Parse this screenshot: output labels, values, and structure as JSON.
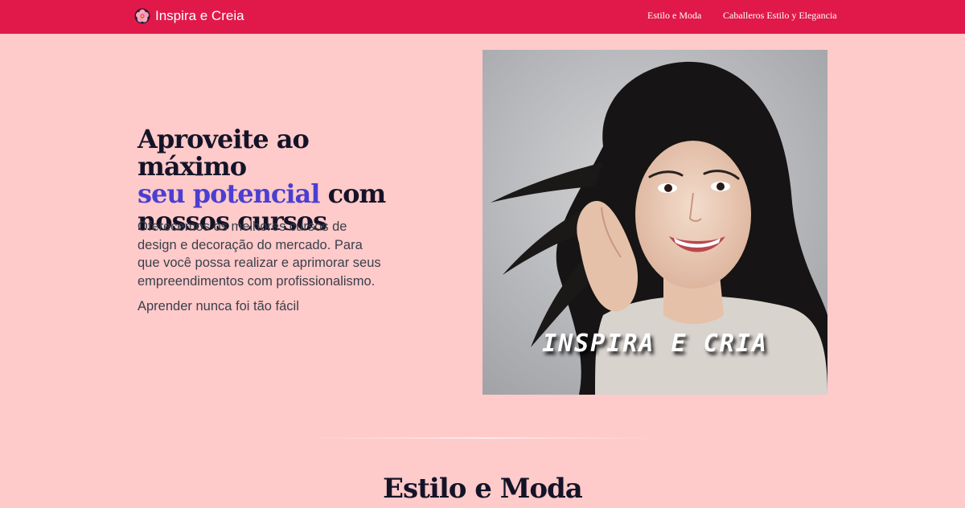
{
  "header": {
    "brand": "Inspira e Creia",
    "brand_icon": "flower-icon",
    "background_color": "#e0194a",
    "nav": [
      {
        "label": "Estilo e Moda"
      },
      {
        "label": "Caballeros Estilo y Elegancia"
      }
    ]
  },
  "hero": {
    "title_part1": "Aproveite ao máximo",
    "title_highlight": "seu potencial",
    "title_part2": "com",
    "title_part3": "nossos cursos",
    "highlight_color": "#4a3fd1",
    "description": "Oferecemos os melhores cursos de design e decoração do mercado. Para que você possa realizar e aprimorar seus empreendimentos com profissionalismo.",
    "tagline": "Aprender nunca foi tão fácil",
    "image_caption": "INSPIRA E CRIA"
  },
  "section": {
    "title": "Estilo e Moda"
  },
  "colors": {
    "page_background": "#ffcaca",
    "text_dark": "#141428"
  }
}
